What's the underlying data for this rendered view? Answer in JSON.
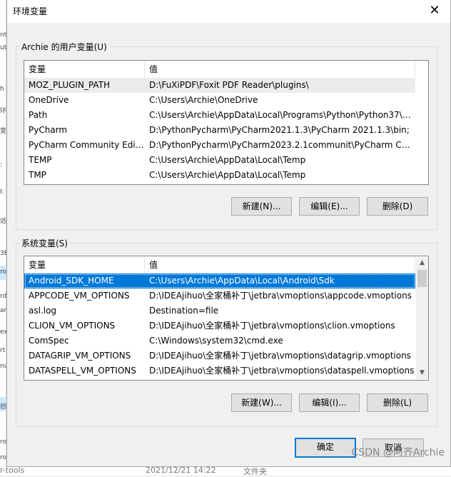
{
  "window": {
    "title": "环境变量",
    "close_glyph": "✕"
  },
  "user_vars": {
    "group_label": "Archie 的用户变量(U)",
    "columns": [
      "变量",
      "值"
    ],
    "rows": [
      {
        "name": "MOZ_PLUGIN_PATH",
        "value": "D:\\FuXiPDF\\Foxit PDF Reader\\plugins\\"
      },
      {
        "name": "OneDrive",
        "value": "C:\\Users\\Archie\\OneDrive"
      },
      {
        "name": "Path",
        "value": "C:\\Users\\Archie\\AppData\\Local\\Programs\\Python\\Python37\\S..."
      },
      {
        "name": "PyCharm",
        "value": "D:\\PythonPycharm\\PyCharm2021.1.3\\PyCharm 2021.1.3\\bin;"
      },
      {
        "name": "PyCharm Community Editi...",
        "value": "D:\\PythonPycharm\\PyCharm2023.2.1communit\\PyCharm Com..."
      },
      {
        "name": "TEMP",
        "value": "C:\\Users\\Archie\\AppData\\Local\\Temp"
      },
      {
        "name": "TMP",
        "value": "C:\\Users\\Archie\\AppData\\Local\\Temp"
      }
    ],
    "buttons": {
      "new": "新建(N)...",
      "edit": "编辑(E)...",
      "delete": "删除(D)"
    }
  },
  "system_vars": {
    "group_label": "系统变量(S)",
    "columns": [
      "变量",
      "值"
    ],
    "rows": [
      {
        "name": "Android_SDK_HOME",
        "value": "C:\\Users\\Archie\\AppData\\Local\\Android\\Sdk"
      },
      {
        "name": "APPCODE_VM_OPTIONS",
        "value": "D:\\IDEAjihuo\\全家桶补丁\\jetbra\\vmoptions\\appcode.vmoptions"
      },
      {
        "name": "asl.log",
        "value": "Destination=file"
      },
      {
        "name": "CLION_VM_OPTIONS",
        "value": "D:\\IDEAjihuo\\全家桶补丁\\jetbra\\vmoptions\\clion.vmoptions"
      },
      {
        "name": "ComSpec",
        "value": "C:\\Windows\\system32\\cmd.exe"
      },
      {
        "name": "DATAGRIP_VM_OPTIONS",
        "value": "D:\\IDEAjihuo\\全家桶补丁\\jetbra\\vmoptions\\datagrip.vmoptions"
      },
      {
        "name": "DATASPELL_VM_OPTIONS",
        "value": "D:\\IDEAjihuo\\全家桶补丁\\jetbra\\vmoptions\\dataspell.vmoptions"
      }
    ],
    "buttons": {
      "new": "新建(W)...",
      "edit": "编辑(I)...",
      "delete": "删除(L)"
    },
    "scroll_up_glyph": "▲",
    "scroll_down_glyph": "▼"
  },
  "footer": {
    "ok": "确定",
    "cancel": "取消"
  },
  "watermark": "CSDN @阿齐Archie",
  "background_app": {
    "left_fragments": [
      "nt",
      "ut",
      "h",
      "环",
      "变",
      ":",
      "I:",
      "远",
      "3E",
      "ro",
      "rd",
      "ar",
      "ex",
      "rt",
      "nu",
      "创",
      "ro",
      "ro"
    ],
    "bottom_name": "r-tools",
    "bottom_date": "2021/12/21 14:22",
    "bottom_type": "文件夹"
  },
  "colors": {
    "selection": "#0078d7",
    "default_button_border": "#0078d7",
    "dialog_bg": "#f0f0f0"
  }
}
